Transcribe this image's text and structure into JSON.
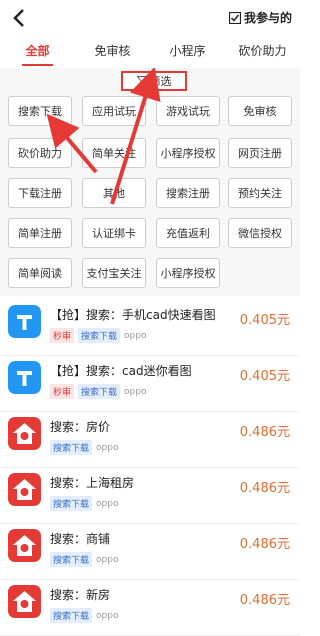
{
  "header": {
    "back_icon": "chevron-left-icon",
    "mine_label": "我参与的"
  },
  "tabs": [
    "全部",
    "免审核",
    "小程序",
    "砍价助力"
  ],
  "filter": {
    "label": "筛选",
    "icon": "filter-icon"
  },
  "chips": [
    "搜索下载",
    "应用试玩",
    "游戏试玩",
    "免审核",
    "砍价助力",
    "简单关注",
    "小程序授权",
    "网页注册",
    "下载注册",
    "其他",
    "搜索注册",
    "预约关注",
    "简单注册",
    "认证绑卡",
    "充值返利",
    "微信授权",
    "简单阅读",
    "支付宝关注",
    "小程序授权"
  ],
  "tasks": [
    {
      "title": "【抢】搜索：手机cad快速看图",
      "tags": [
        "秒审",
        "搜索下载",
        "oppo"
      ],
      "price": "0.405元",
      "icon": "cad-app-icon"
    },
    {
      "title": "【抢】搜索：cad迷你看图",
      "tags": [
        "秒审",
        "搜索下载",
        "oppo"
      ],
      "price": "0.405元",
      "icon": "cad-app-icon"
    },
    {
      "title": "搜索：房价",
      "tags": [
        "搜索下载",
        "oppo"
      ],
      "price": "0.486元",
      "icon": "house-app-icon"
    },
    {
      "title": "搜索：上海租房",
      "tags": [
        "搜索下载",
        "oppo"
      ],
      "price": "0.486元",
      "icon": "house-app-icon"
    },
    {
      "title": "搜索：商铺",
      "tags": [
        "搜索下载",
        "oppo"
      ],
      "price": "0.486元",
      "icon": "house-app-icon"
    },
    {
      "title": "搜索：新房",
      "tags": [
        "搜索下载",
        "oppo"
      ],
      "price": "0.486元",
      "icon": "house-app-icon"
    }
  ],
  "colors": {
    "accent": "#e53935",
    "price": "#e86a2e"
  }
}
